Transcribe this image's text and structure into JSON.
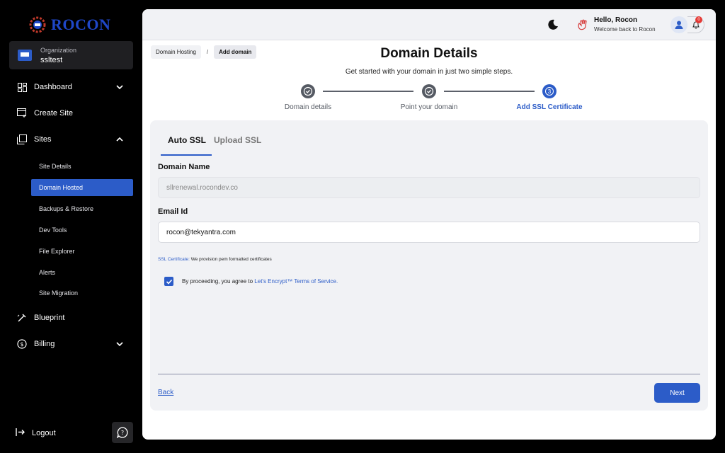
{
  "brand": {
    "name": "ROCON"
  },
  "org": {
    "label": "Organization",
    "name": "ssltest"
  },
  "nav": {
    "dashboard": "Dashboard",
    "create_site": "Create Site",
    "sites": "Sites",
    "sub_items": [
      "Site Details",
      "Domain Hosted",
      "Backups & Restore",
      "Dev Tools",
      "File Explorer",
      "Alerts",
      "Site Migration"
    ],
    "blueprint": "Blueprint",
    "billing": "Billing",
    "logout": "Logout"
  },
  "header": {
    "greeting": "Hello, Rocon",
    "welcome": "Welcome back to Rocon",
    "notifications": "0"
  },
  "breadcrumb": {
    "parent": "Domain Hosting",
    "separator": "/",
    "current": "Add domain"
  },
  "page": {
    "title": "Domain Details",
    "subtitle": "Get started with your domain in just two simple steps."
  },
  "steps": [
    {
      "label": "Domain details",
      "state": "done"
    },
    {
      "label": "Point your domain",
      "state": "done"
    },
    {
      "label": "Add SSL Certificate",
      "state": "current",
      "number": "3"
    }
  ],
  "tabs": {
    "auto": "Auto SSL",
    "upload": "Upload SSL"
  },
  "form": {
    "domain_label": "Domain Name",
    "domain_value": "sllrenewal.rocondev.co",
    "email_label": "Email Id",
    "email_value": "rocon@tekyantra.com",
    "note_link": "SSL Certificate:",
    "note_text": " We provision pem formatted certificates",
    "agree_text": "By proceeding, you agree to ",
    "agree_link": "Let's Encrypt™ Terms of Service."
  },
  "actions": {
    "back": "Back",
    "next": "Next"
  },
  "colors": {
    "accent": "#2c5cc8",
    "brand": "#1f47c8",
    "badge": "#e53935"
  }
}
